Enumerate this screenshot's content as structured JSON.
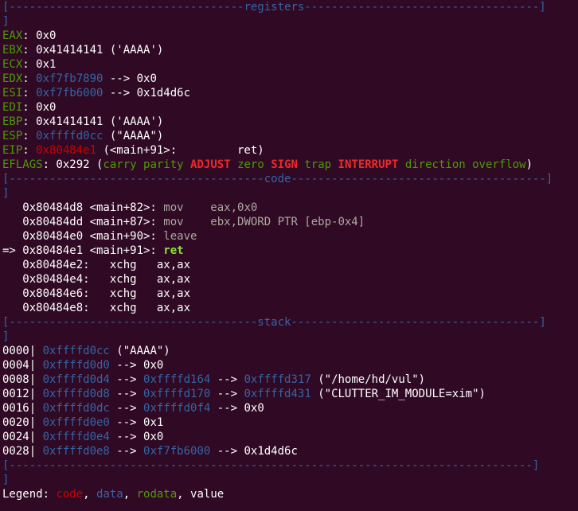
{
  "separators": {
    "registers": {
      "left": "[-----------------------------------",
      "title": "registers",
      "right": "-----------------------------------]"
    },
    "code": {
      "left": "[--------------------------------------",
      "title": "code",
      "right": "--------------------------------------]"
    },
    "stack": {
      "left": "[-------------------------------------",
      "title": "stack",
      "right": "-------------------------------------]"
    },
    "end": {
      "text": "[------------------------------------------------------------------------------]"
    }
  },
  "registers": {
    "eax": {
      "name": "EAX",
      "sep": ": ",
      "value": "0x0"
    },
    "ebx": {
      "name": "EBX",
      "sep": ": ",
      "value": "0x41414141 ('AAAA')"
    },
    "ecx": {
      "name": "ECX",
      "sep": ": ",
      "value": "0x1"
    },
    "edx": {
      "name": "EDX",
      "sep": ": ",
      "addr": "0xf7fb7890",
      "rest": " --> 0x0"
    },
    "esi": {
      "name": "ESI",
      "sep": ": ",
      "addr": "0xf7fb6000",
      "rest": " --> 0x1d4d6c"
    },
    "edi": {
      "name": "EDI",
      "sep": ": ",
      "value": "0x0"
    },
    "ebp": {
      "name": "EBP",
      "sep": ": ",
      "value": "0x41414141 ('AAAA')"
    },
    "esp": {
      "name": "ESP",
      "sep": ": ",
      "addr": "0xffffd0cc",
      "rest": " (\"AAAA\")"
    },
    "eip": {
      "name": "EIP",
      "sep": ": ",
      "addr": "0x80484e1",
      "rest": " (<main+91>:\t   ret)"
    },
    "eflags": {
      "name": "EFLAGS",
      "value": ": 0x292 (",
      "carry": "carry",
      "parity": "parity",
      "adjust": "ADJUST",
      "zero": "zero",
      "sign": "SIGN",
      "trap": "trap",
      "interrupt": "INTERRUPT",
      "direction": "direction",
      "overflow": "overflow",
      "close": ")"
    }
  },
  "code": {
    "l1": {
      "addr": "   0x80484d8 <main+82>: ",
      "instr": "mov    eax,0x0"
    },
    "l2": {
      "addr": "   0x80484dd <main+87>: ",
      "instr": "mov    ebx,DWORD PTR [ebp-0x4]"
    },
    "l3": {
      "addr": "   0x80484e0 <main+90>: ",
      "instr": "leave"
    },
    "l4": {
      "addr": "=> 0x80484e1 <main+91>: ",
      "instr": "ret"
    },
    "l5": {
      "text": "   0x80484e2:   xchg   ax,ax"
    },
    "l6": {
      "text": "   0x80484e4:   xchg   ax,ax"
    },
    "l7": {
      "text": "   0x80484e6:   xchg   ax,ax"
    },
    "l8": {
      "text": "   0x80484e8:   xchg   ax,ax"
    }
  },
  "stack": {
    "s0": {
      "offset": "0000| ",
      "a1": "0xffffd0cc",
      "rest": " (\"AAAA\")"
    },
    "s1": {
      "offset": "0004| ",
      "a1": "0xffffd0d0",
      "rest": " --> 0x0"
    },
    "s2": {
      "offset": "0008| ",
      "a1": "0xffffd0d4",
      "arrow1": " --> ",
      "a2": "0xffffd164",
      "arrow2": " --> ",
      "a3": "0xffffd317",
      "rest": " (\"/home/hd/vul\")"
    },
    "s3": {
      "offset": "0012| ",
      "a1": "0xffffd0d8",
      "arrow1": " --> ",
      "a2": "0xffffd170",
      "arrow2": " --> ",
      "a3": "0xffffd431",
      "rest": " (\"CLUTTER_IM_MODULE=xim\")"
    },
    "s4": {
      "offset": "0016| ",
      "a1": "0xffffd0dc",
      "arrow1": " --> ",
      "a2": "0xffffd0f4",
      "rest": " --> 0x0"
    },
    "s5": {
      "offset": "0020| ",
      "a1": "0xffffd0e0",
      "rest": " --> 0x1"
    },
    "s6": {
      "offset": "0024| ",
      "a1": "0xffffd0e4",
      "rest": " --> 0x0"
    },
    "s7": {
      "offset": "0028| ",
      "a1": "0xffffd0e8",
      "arrow1": " --> ",
      "a2": "0xf7fb6000",
      "rest": " --> 0x1d4d6c"
    }
  },
  "legend": {
    "label": "Legend: ",
    "code": "code",
    "c1": ", ",
    "data": "data",
    "c2": ", ",
    "rodata": "rodata",
    "c3": ", ",
    "value": "value"
  },
  "colors": {
    "background": "#300a24",
    "address": "#3465a4",
    "register": "#4e9a06",
    "code": "#cc0000",
    "flag_set": "#ef2929",
    "text": "#ffffff"
  }
}
